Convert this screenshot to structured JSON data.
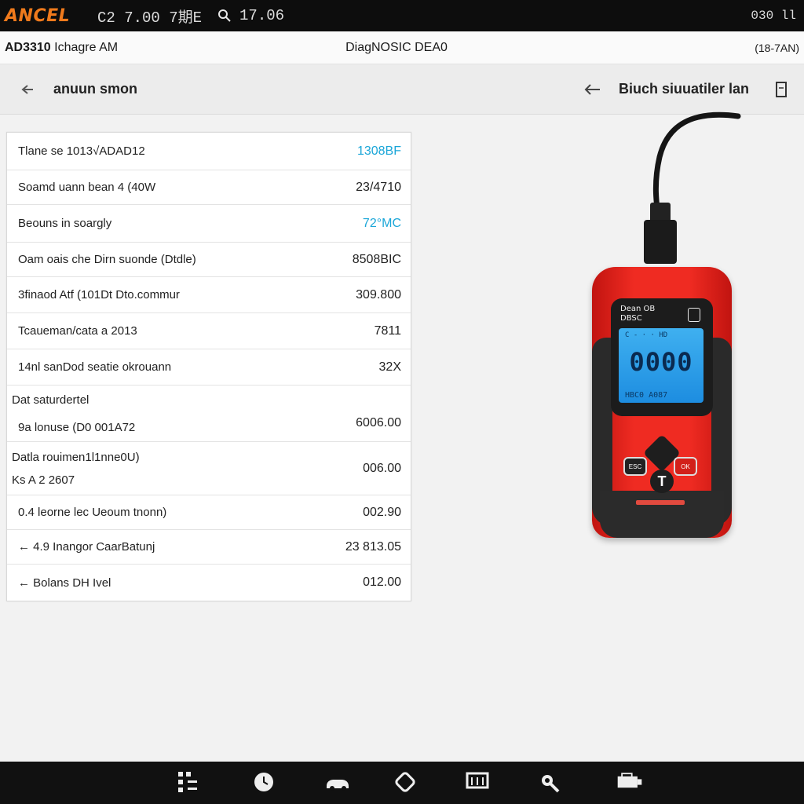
{
  "statusbar": {
    "brand": "ANCEL",
    "time": "C2 7.00 7期E",
    "search_value": "17.06",
    "right_text": "030 ll"
  },
  "titlebar": {
    "left_bold": "AD3310",
    "left_rest": " Ichagre AM",
    "center": "DiagNOSIC DEA0",
    "right": "(18-7AN)"
  },
  "toolbar": {
    "left_label": "anuun smon",
    "right_label": "Biuch siuuatiler lan"
  },
  "table": {
    "rows": [
      {
        "label": "Tlane se 1013√ADAD12",
        "value": "1308BF",
        "value_color": "#1aa6d8"
      },
      {
        "label": "Soamd uann bean 4 (40W",
        "value": "23/4710"
      },
      {
        "label": "Beouns in soargly",
        "value": "72°MC",
        "value_color": "#1aa6d8"
      },
      {
        "label": "Oam oais che Dirn suonde (Dtdle)",
        "value": "8508BIC"
      },
      {
        "label": "3finaod Atf (101Dt Dto.commur",
        "value": "309.800"
      },
      {
        "label": "Tcaueman/cata a 2013",
        "value": "7811"
      },
      {
        "label": "14nl sanDod seatie okrouann",
        "value": "32X"
      },
      {
        "label": "Dat saturdertel",
        "label2": "9a lonuse (D0 001A72",
        "value": "6006.00"
      },
      {
        "label": "Datla rouimen1l1nne0U)",
        "label2": "Ks A 2 2607",
        "value": "006.00"
      },
      {
        "label": "0.4 leorne lec Ueoum tnonn)",
        "value": "002.90"
      },
      {
        "label": "← 4.9 Inangor CaarBatunj",
        "value": "23 813.05"
      },
      {
        "label": "← Bolans DH Ivel",
        "value": "012.00"
      }
    ]
  },
  "device": {
    "top_text_1": "Dean OB",
    "top_text_2": "DBSC",
    "screen_small": "C  - ·  ·   HD",
    "screen_big": "0000",
    "screen_bottom": "HBC0  A087",
    "btn_left": "ESC",
    "btn_right": "OK",
    "btn_center": "T",
    "cable_color": "#1a1a1a",
    "body_color": "#ef2b22"
  },
  "dock": {
    "items": [
      "apps-grid-icon",
      "clock-icon",
      "car-icon",
      "tag-icon",
      "calendar-icon",
      "settings-key-icon",
      "print-icon"
    ]
  },
  "colors": {
    "accent_orange": "#f07a1c",
    "accent_blue": "#1aa6d8",
    "device_red": "#ef2b22"
  }
}
